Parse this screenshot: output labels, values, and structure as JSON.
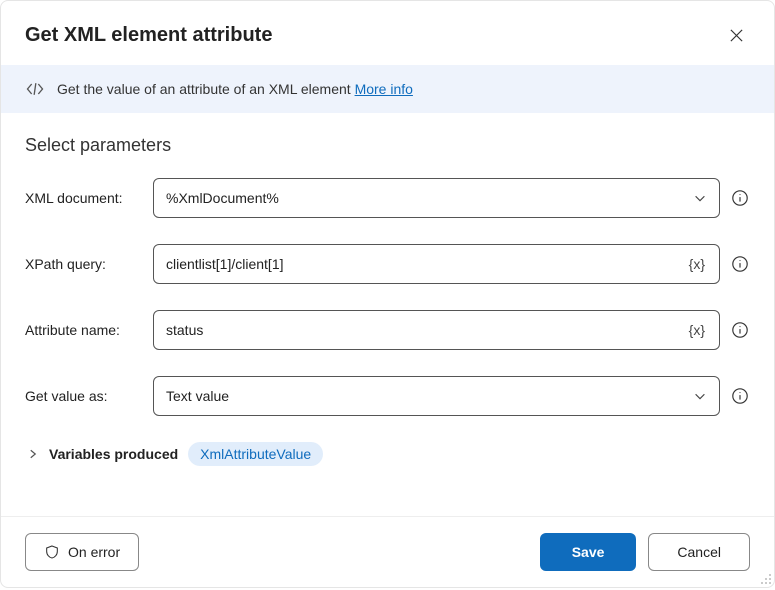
{
  "header": {
    "title": "Get XML element attribute"
  },
  "banner": {
    "text": "Get the value of an attribute of an XML element ",
    "more_info": "More info"
  },
  "section": {
    "title": "Select parameters"
  },
  "fields": {
    "xml_document": {
      "label": "XML document:",
      "value": "%XmlDocument%"
    },
    "xpath_query": {
      "label": "XPath query:",
      "value": "clientlist[1]/client[1]"
    },
    "attribute": {
      "label": "Attribute name:",
      "value": "status"
    },
    "get_value_as": {
      "label": "Get value as:",
      "value": "Text value"
    }
  },
  "variables_produced": {
    "label": "Variables produced",
    "pill": "XmlAttributeValue"
  },
  "footer": {
    "on_error": "On error",
    "save": "Save",
    "cancel": "Cancel"
  }
}
